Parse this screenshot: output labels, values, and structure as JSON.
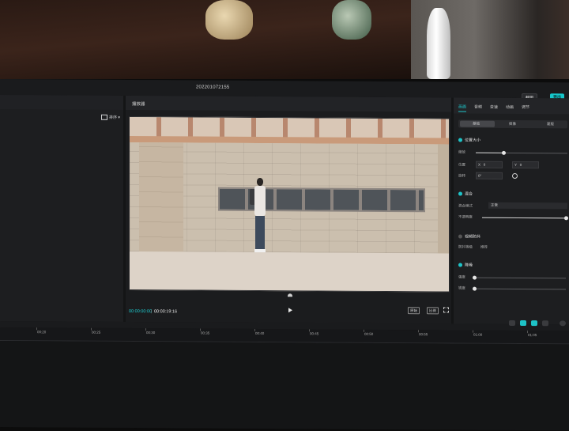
{
  "project_title": "202201072155",
  "titlebar": {
    "screenshot_label": "截图",
    "export_label": "导出"
  },
  "media_panel": {
    "sort_label": "排序"
  },
  "player": {
    "panel_label": "播放器",
    "current_time": "00:00:00:00",
    "separator": "|",
    "total_time": "00:00:19:16",
    "ratio_a": "原始",
    "ratio_b": "比例"
  },
  "properties": {
    "tabs": [
      "画面",
      "音频",
      "变速",
      "动画",
      "调节"
    ],
    "active_tab": 0,
    "subtabs": [
      "基础",
      "抠像",
      "蒙版"
    ],
    "sections": {
      "position_size": "位置大小",
      "scale_label": "缩放",
      "position_label": "位置",
      "x_label": "X",
      "x_value": "0",
      "y_label": "Y",
      "y_value": "0",
      "rotate_label": "旋转",
      "rotate_value": "0°",
      "blend": "混合",
      "blend_mode_label": "混合模式",
      "blend_mode_value": "正常",
      "opacity_label": "不透明度",
      "stabilize": "视频防抖",
      "stabilize_level_label": "防抖等级",
      "stabilize_level_value": "推荐",
      "denoise": "降噪",
      "denoise_label": "强度",
      "denoise_label2": "锐度"
    },
    "scale_level": 0.3,
    "opacity_level": 1.0
  },
  "timeline": {
    "ticks": [
      "00:20",
      "00:25",
      "00:30",
      "00:35",
      "00:40",
      "00:45",
      "00:50",
      "00:55",
      "01:00",
      "01:05",
      "01:10"
    ]
  },
  "colors": {
    "accent": "#1ec3c7",
    "background": "#141516",
    "panel": "#1d1e20"
  }
}
